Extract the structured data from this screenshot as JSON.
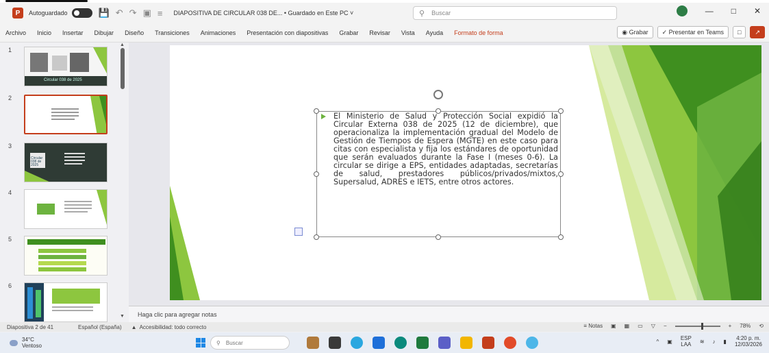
{
  "window": {
    "autosave_label": "Autoguardado",
    "doc_title": "DIAPOSITIVA DE CIRCULAR 038 DE...  •  Guardado en Este PC ˅",
    "search_placeholder": "Buscar"
  },
  "ribbon": {
    "tabs": [
      "Archivo",
      "Inicio",
      "Insertar",
      "Dibujar",
      "Diseño",
      "Transiciones",
      "Animaciones",
      "Presentación con diapositivas",
      "Grabar",
      "Revisar",
      "Vista",
      "Ayuda",
      "Formato de forma"
    ],
    "record_label": "Grabar",
    "teams_label": "Presentar en Teams"
  },
  "thumbnails": {
    "items": [
      {
        "number": "1",
        "caption": "Circular 038 de 2025"
      },
      {
        "number": "2"
      },
      {
        "number": "3",
        "caption": "Circular 038 de 2025"
      },
      {
        "number": "4"
      },
      {
        "number": "5"
      },
      {
        "number": "6"
      }
    ]
  },
  "slide": {
    "body_text": "El Ministerio de Salud y Protección Social expidió la Circular Externa 038 de 2025 (12 de diciembre), que operacionaliza la implementación gradual del Modelo de Gestión de Tiempos de Espera (MGTE) en este caso para citas con especialista y fija los estándares de oportunidad que serán evaluados durante la Fase I (meses 0-6). La circular se dirige a EPS, entidades adaptadas, secretarías de salud, prestadores públicos/privados/mixtos, Supersalud, ADRES e IETS, entre otros actores."
  },
  "notes": {
    "placeholder": "Haga clic para agregar notas"
  },
  "status": {
    "slide_position": "Diapositiva 2 de 41",
    "language": "Español (España)",
    "accessibility": "Accesibilidad: todo correcto",
    "notes_label": "Notas",
    "zoom": "78%"
  },
  "taskbar": {
    "temp": "34°C",
    "weather": "Ventoso",
    "search_placeholder": "Buscar",
    "lang_top": "ESP",
    "lang_bottom": "LAA",
    "time": "4:20 p. m.",
    "date": "12/03/2026"
  },
  "colors": {
    "accent": "#c43e1c",
    "green_light": "#8dc63f",
    "green_dark": "#3f8f1f"
  }
}
